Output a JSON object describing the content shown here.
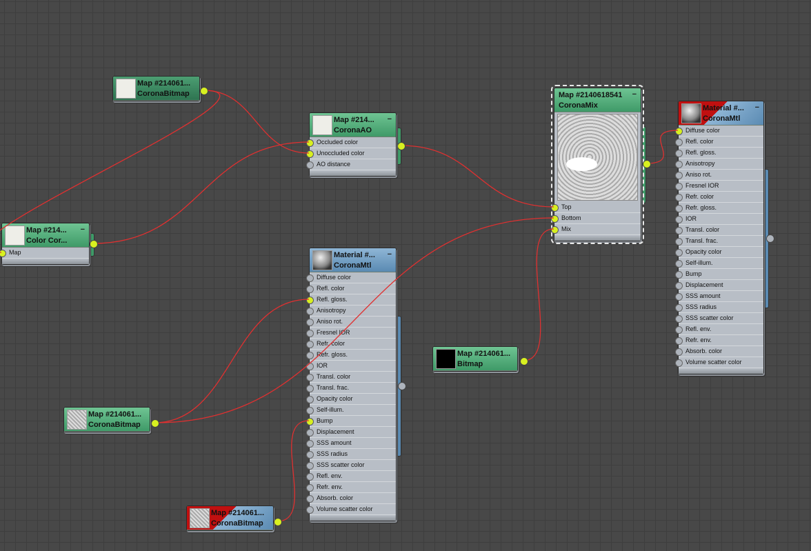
{
  "nodes": [
    {
      "id": "bitmap_top",
      "title": "Map #214061...",
      "type": "CoronaBitmap",
      "style": "mapdark",
      "thumb": "white",
      "inputs": []
    },
    {
      "id": "ao",
      "title": "Map #214...",
      "type": "CoronaAO",
      "style": "map",
      "thumb": "white",
      "inputs": [
        {
          "label": "Occluded color",
          "connected": true
        },
        {
          "label": "Unoccluded color",
          "connected": true
        },
        {
          "label": "AO distance",
          "connected": false
        }
      ]
    },
    {
      "id": "colorcorr",
      "title": "Map #214...",
      "type": "Color Cor...",
      "style": "map",
      "thumb": "white",
      "inputs": [
        {
          "label": "Map",
          "connected": true
        }
      ]
    },
    {
      "id": "mix",
      "title": "Map #2140618541",
      "type": "CoronaMix",
      "style": "map",
      "thumb": "none",
      "selected": true,
      "inputs": [
        {
          "label": "Top",
          "connected": true
        },
        {
          "label": "Bottom",
          "connected": true
        },
        {
          "label": "Mix",
          "connected": true
        }
      ]
    },
    {
      "id": "mtl_right",
      "title": "Material #...",
      "type": "CoronaMtl",
      "style": "red",
      "thumb": "sphere",
      "inputs": [
        {
          "label": "Diffuse color",
          "connected": true
        },
        {
          "label": "Refl. color"
        },
        {
          "label": "Refl. gloss."
        },
        {
          "label": "Anisotropy"
        },
        {
          "label": "Aniso rot."
        },
        {
          "label": "Fresnel IOR"
        },
        {
          "label": "Refr. color"
        },
        {
          "label": "Refr. gloss."
        },
        {
          "label": "IOR"
        },
        {
          "label": "Transl. color"
        },
        {
          "label": "Transl. frac."
        },
        {
          "label": "Opacity color"
        },
        {
          "label": "Self-illum."
        },
        {
          "label": "Bump"
        },
        {
          "label": "Displacement"
        },
        {
          "label": "SSS amount"
        },
        {
          "label": "SSS radius"
        },
        {
          "label": "SSS scatter color"
        },
        {
          "label": "Refl. env."
        },
        {
          "label": "Refr. env."
        },
        {
          "label": "Absorb. color"
        },
        {
          "label": "Volume scatter color"
        }
      ]
    },
    {
      "id": "mtl_mid",
      "title": "Material #...",
      "type": "CoronaMtl",
      "style": "mtl",
      "thumb": "sphere",
      "inputs": [
        {
          "label": "Diffuse color"
        },
        {
          "label": "Refl. color"
        },
        {
          "label": "Refl. gloss.",
          "connected": true
        },
        {
          "label": "Anisotropy"
        },
        {
          "label": "Aniso rot."
        },
        {
          "label": "Fresnel IOR"
        },
        {
          "label": "Refr. color"
        },
        {
          "label": "Refr. gloss."
        },
        {
          "label": "IOR"
        },
        {
          "label": "Transl. color"
        },
        {
          "label": "Transl. frac."
        },
        {
          "label": "Opacity color"
        },
        {
          "label": "Self-illum."
        },
        {
          "label": "Bump",
          "connected": true
        },
        {
          "label": "Displacement"
        },
        {
          "label": "SSS amount"
        },
        {
          "label": "SSS radius"
        },
        {
          "label": "SSS scatter color"
        },
        {
          "label": "Refl. env."
        },
        {
          "label": "Refr. env."
        },
        {
          "label": "Absorb. color"
        },
        {
          "label": "Volume scatter color"
        }
      ]
    },
    {
      "id": "bitmap_mix",
      "title": "Map #214061...",
      "type": "Bitmap",
      "style": "map",
      "thumb": "bw",
      "inputs": []
    },
    {
      "id": "bitmap_left",
      "title": "Map #214061...",
      "type": "CoronaBitmap",
      "style": "map",
      "thumb": "tex",
      "inputs": []
    },
    {
      "id": "bitmap_bump",
      "title": "Map #214061...",
      "type": "CoronaBitmap",
      "style": "red",
      "thumb": "tex",
      "inputs": []
    }
  ],
  "minimize_glyph": "−",
  "colors": {
    "wire": "#e03030",
    "socket_connected": "#d8f020",
    "map_header": "#4fae7a",
    "material_header": "#6f9cc2"
  }
}
